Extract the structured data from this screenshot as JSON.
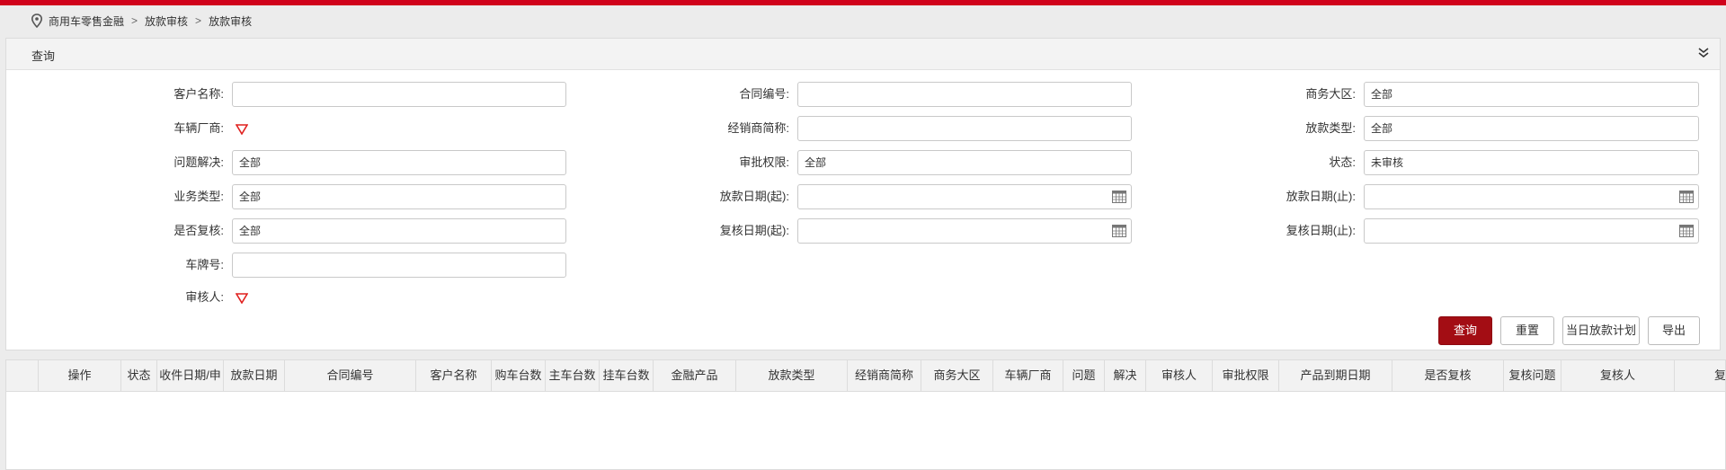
{
  "breadcrumb": [
    "商用车零售金融",
    "放款审核",
    "放款审核"
  ],
  "breadcrumb_sep": ">",
  "panel": {
    "title": "查询"
  },
  "form": {
    "customer_name": {
      "label": "客户名称:",
      "value": ""
    },
    "contract_no": {
      "label": "合同编号:",
      "value": ""
    },
    "business_region": {
      "label": "商务大区:",
      "value": "全部"
    },
    "vehicle_maker": {
      "label": "车辆厂商:"
    },
    "dealer_short": {
      "label": "经销商简称:",
      "value": ""
    },
    "loan_type": {
      "label": "放款类型:",
      "value": "全部"
    },
    "issue_resolved": {
      "label": "问题解决:",
      "value": "全部"
    },
    "approval_authority": {
      "label": "审批权限:",
      "value": "全部"
    },
    "status": {
      "label": "状态:",
      "value": "未审核"
    },
    "business_type": {
      "label": "业务类型:",
      "value": "全部"
    },
    "loan_date_from": {
      "label": "放款日期(起):",
      "value": ""
    },
    "loan_date_to": {
      "label": "放款日期(止):",
      "value": ""
    },
    "is_recheck": {
      "label": "是否复核:",
      "value": "全部"
    },
    "recheck_date_from": {
      "label": "复核日期(起):",
      "value": ""
    },
    "recheck_date_to": {
      "label": "复核日期(止):",
      "value": ""
    },
    "plate_no": {
      "label": "车牌号:",
      "value": ""
    },
    "auditor": {
      "label": "审核人:"
    }
  },
  "buttons": {
    "query": "查询",
    "reset": "重置",
    "today_plan": "当日放款计划",
    "export": "导出"
  },
  "table": {
    "columns": [
      "操作",
      "状态",
      "收件日期/申",
      "放款日期",
      "合同编号",
      "客户名称",
      "购车台数",
      "主车台数",
      "挂车台数",
      "金融产品",
      "放款类型",
      "经销商简称",
      "商务大区",
      "车辆厂商",
      "问题",
      "解决",
      "审核人",
      "审批权限",
      "产品到期日期",
      "是否复核",
      "复核问题",
      "复核人",
      "复"
    ]
  },
  "colors": {
    "brand_red": "#d0021b",
    "primary_button": "#a30d14",
    "dropdown_triangle": "#e0211f"
  }
}
